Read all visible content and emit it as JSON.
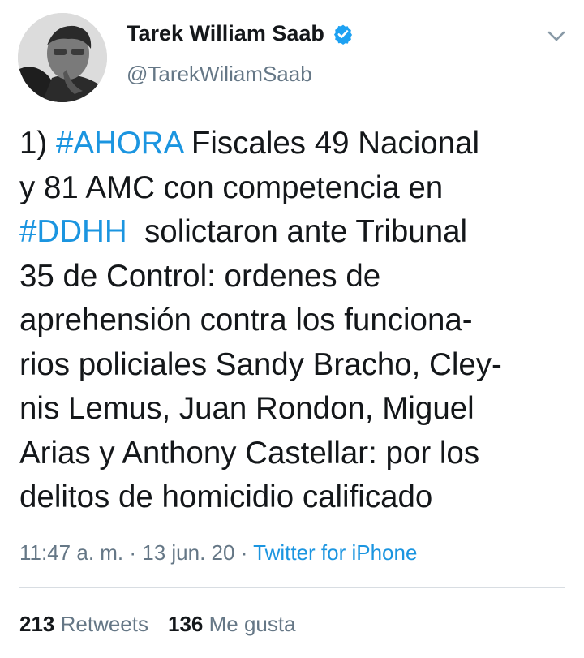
{
  "author": {
    "name": "Tarek William Saab",
    "handle": "@TarekWiliamSaab",
    "verified": true
  },
  "tweet": {
    "lines": [
      {
        "parts": [
          {
            "text": "1) ",
            "type": "text"
          },
          {
            "text": "#AHORA",
            "type": "hashtag"
          },
          {
            "text": " Fiscales 49 Nacional",
            "type": "text"
          }
        ]
      },
      {
        "parts": [
          {
            "text": "y 81 AMC con competencia en",
            "type": "text"
          }
        ]
      },
      {
        "parts": [
          {
            "text": "#DDHH",
            "type": "hashtag"
          },
          {
            "text": "  solictaron ante Tribunal",
            "type": "text"
          }
        ]
      },
      {
        "parts": [
          {
            "text": "35 de Control: ordenes de",
            "type": "text"
          }
        ]
      },
      {
        "parts": [
          {
            "text": "aprehensión contra los funciona-",
            "type": "text"
          }
        ]
      },
      {
        "parts": [
          {
            "text": "rios policiales Sandy Bracho, Cley-",
            "type": "text"
          }
        ]
      },
      {
        "parts": [
          {
            "text": "nis Lemus, Juan Rondon, Miguel",
            "type": "text"
          }
        ]
      },
      {
        "parts": [
          {
            "text": "Arias y Anthony Castellar: por los",
            "type": "text"
          }
        ]
      },
      {
        "parts": [
          {
            "text": "delitos de homicidio calificado",
            "type": "text"
          }
        ]
      }
    ]
  },
  "meta": {
    "time": "11:47 a. m.",
    "separator": " · ",
    "date": "13 jun. 20",
    "source": "Twitter for iPhone"
  },
  "stats": {
    "retweets_count": "213",
    "retweets_label": " Retweets",
    "likes_count": "136",
    "likes_label": " Me gusta"
  },
  "icons": {
    "verified": "verified-badge-icon",
    "menu": "chevron-down-icon"
  },
  "colors": {
    "link": "#1b95e0",
    "secondary_text": "#657786",
    "primary_text": "#14171a"
  }
}
